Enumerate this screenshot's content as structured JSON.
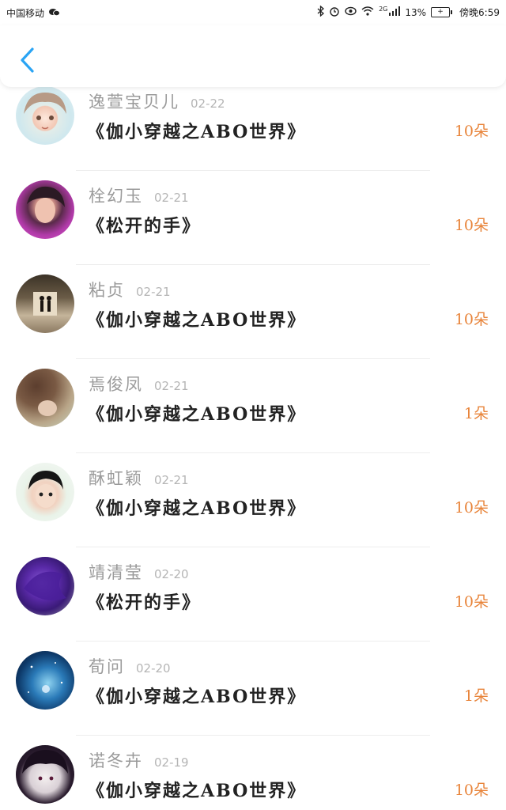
{
  "status_bar": {
    "carrier": "中国移动",
    "network": "2G",
    "battery_percent": "13%",
    "time": "傍晚6:59"
  },
  "header": {
    "back_icon": "chevron-left-icon",
    "accent_color": "#2aa4f4"
  },
  "gifts": [
    {
      "name": "逸萱宝贝儿",
      "date": "02-22",
      "title": "《伽小穿越之ABO世界》",
      "count": "10朵"
    },
    {
      "name": "栓幻玉",
      "date": "02-21",
      "title": "《松开的手》",
      "count": "10朵"
    },
    {
      "name": "粘贞",
      "date": "02-21",
      "title": "《伽小穿越之ABO世界》",
      "count": "10朵"
    },
    {
      "name": "焉俊凤",
      "date": "02-21",
      "title": "《伽小穿越之ABO世界》",
      "count": "1朵"
    },
    {
      "name": "酥虹颖",
      "date": "02-21",
      "title": "《伽小穿越之ABO世界》",
      "count": "10朵"
    },
    {
      "name": "靖清莹",
      "date": "02-20",
      "title": "《松开的手》",
      "count": "10朵"
    },
    {
      "name": "荀问",
      "date": "02-20",
      "title": "《伽小穿越之ABO世界》",
      "count": "1朵"
    },
    {
      "name": "诺冬卉",
      "date": "02-19",
      "title": "《伽小穿越之ABO世界》",
      "count": "10朵"
    }
  ],
  "colors": {
    "count": "#e8843a",
    "name": "#9a9a9a",
    "title": "#222222"
  }
}
